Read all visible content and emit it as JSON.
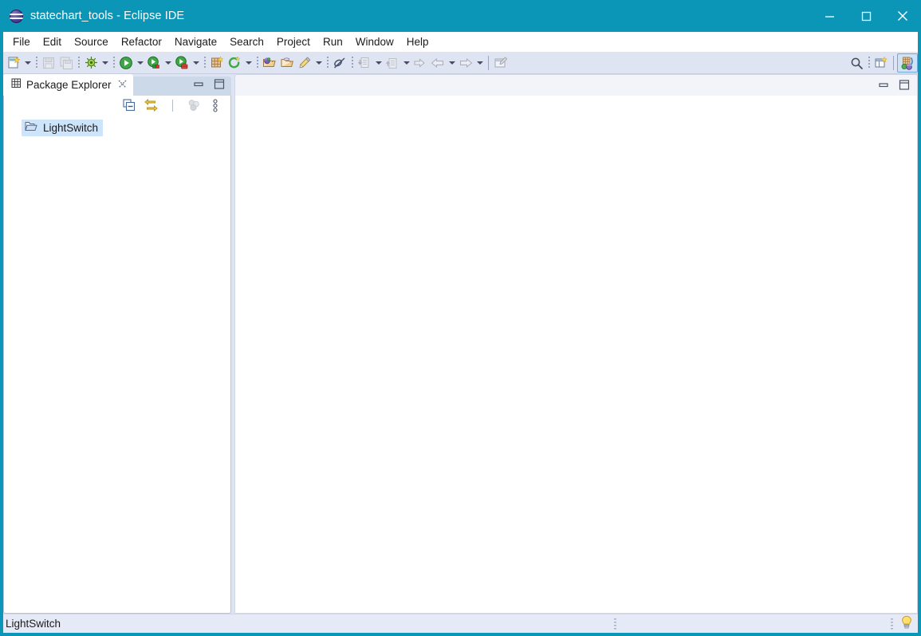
{
  "window": {
    "title": "statechart_tools - Eclipse IDE",
    "logo_icon": "eclipse-logo-icon",
    "accent_color": "#0b96b8",
    "controls": {
      "minimize": "minimize-icon",
      "maximize": "maximize-icon",
      "close": "close-icon"
    }
  },
  "menubar": {
    "items": [
      {
        "label": "File"
      },
      {
        "label": "Edit"
      },
      {
        "label": "Source"
      },
      {
        "label": "Refactor"
      },
      {
        "label": "Navigate"
      },
      {
        "label": "Search"
      },
      {
        "label": "Project"
      },
      {
        "label": "Run"
      },
      {
        "label": "Window"
      },
      {
        "label": "Help"
      }
    ]
  },
  "toolbar": {
    "items": [
      {
        "name": "new-wizard-button",
        "icon": "new-file-icon",
        "enabled": true
      },
      {
        "name": "new-wizard-dropdown",
        "icon": "chevron-down-icon",
        "enabled": true
      },
      {
        "name": "save-button",
        "icon": "save-icon",
        "enabled": false
      },
      {
        "name": "save-all-button",
        "icon": "save-all-icon",
        "enabled": false
      },
      {
        "name": "debug-button",
        "icon": "debug-bug-icon",
        "enabled": true
      },
      {
        "name": "debug-dropdown",
        "icon": "chevron-down-icon",
        "enabled": true
      },
      {
        "name": "run-button",
        "icon": "run-play-icon",
        "enabled": true
      },
      {
        "name": "run-dropdown",
        "icon": "chevron-down-icon",
        "enabled": true
      },
      {
        "name": "run-external-tools-button",
        "icon": "run-server-icon",
        "enabled": true
      },
      {
        "name": "run-external-tools-dropdown",
        "icon": "chevron-down-icon",
        "enabled": true
      },
      {
        "name": "run-coverage-button",
        "icon": "run-coverage-icon",
        "enabled": true
      },
      {
        "name": "run-coverage-dropdown",
        "icon": "chevron-down-icon",
        "enabled": true
      },
      {
        "name": "new-package-button",
        "icon": "new-package-icon",
        "enabled": true
      },
      {
        "name": "refresh-button",
        "icon": "refresh-circle-icon",
        "enabled": true
      },
      {
        "name": "refresh-dropdown",
        "icon": "chevron-down-icon",
        "enabled": true
      },
      {
        "name": "open-type-button",
        "icon": "open-type-icon",
        "enabled": true
      },
      {
        "name": "open-task-button",
        "icon": "open-folder-icon",
        "enabled": true
      },
      {
        "name": "marker-button",
        "icon": "pencil-marker-icon",
        "enabled": true
      },
      {
        "name": "marker-dropdown",
        "icon": "chevron-down-icon",
        "enabled": true
      },
      {
        "name": "skip-breakpoints-button",
        "icon": "skip-breakpoints-icon",
        "enabled": true
      },
      {
        "name": "next-annotation-button",
        "icon": "next-annotation-icon",
        "enabled": false
      },
      {
        "name": "next-annotation-dropdown",
        "icon": "chevron-down-icon",
        "enabled": false
      },
      {
        "name": "previous-annotation-button",
        "icon": "previous-annotation-icon",
        "enabled": false
      },
      {
        "name": "previous-annotation-dropdown",
        "icon": "chevron-down-icon",
        "enabled": false
      },
      {
        "name": "last-edit-location-button",
        "icon": "last-edit-icon",
        "enabled": false
      },
      {
        "name": "back-button",
        "icon": "back-arrow-icon",
        "enabled": false
      },
      {
        "name": "back-dropdown",
        "icon": "chevron-down-icon",
        "enabled": false
      },
      {
        "name": "forward-button",
        "icon": "forward-arrow-icon",
        "enabled": false
      },
      {
        "name": "forward-dropdown",
        "icon": "chevron-down-icon",
        "enabled": false
      },
      {
        "name": "new-editor-button",
        "icon": "new-editor-icon",
        "enabled": true
      }
    ],
    "right_items": [
      {
        "name": "quick-access-search-button",
        "icon": "search-icon"
      },
      {
        "name": "open-perspective-button",
        "icon": "open-perspective-icon"
      },
      {
        "name": "java-perspective-button",
        "icon": "java-perspective-icon",
        "selected": true
      }
    ]
  },
  "package_explorer": {
    "tab": {
      "icon": "package-explorer-icon",
      "label": "Package Explorer",
      "close_icon": "close-tab-icon"
    },
    "part_buttons": {
      "minimize": "minimize-view-icon",
      "maximize": "maximize-view-icon"
    },
    "view_toolbar": [
      {
        "name": "collapse-all-button",
        "icon": "collapse-all-icon",
        "enabled": true
      },
      {
        "name": "link-with-editor-button",
        "icon": "link-with-editor-icon",
        "enabled": true
      },
      {
        "name": "focus-on-active-task-button",
        "icon": "focus-active-task-icon",
        "enabled": false
      },
      {
        "name": "view-menu-button",
        "icon": "view-menu-icon",
        "enabled": true
      }
    ],
    "tree": [
      {
        "label": "LightSwitch",
        "icon": "open-project-folder-icon",
        "selected": true
      }
    ]
  },
  "editor_area": {
    "part_buttons": {
      "minimize": "minimize-view-icon",
      "maximize": "maximize-view-icon"
    },
    "tabs": [],
    "content": ""
  },
  "statusbar": {
    "text": "LightSwitch",
    "middle_handle": "drag-handle-icon",
    "right_handle": "drag-handle-icon",
    "tip_icon": "lightbulb-tip-icon"
  }
}
